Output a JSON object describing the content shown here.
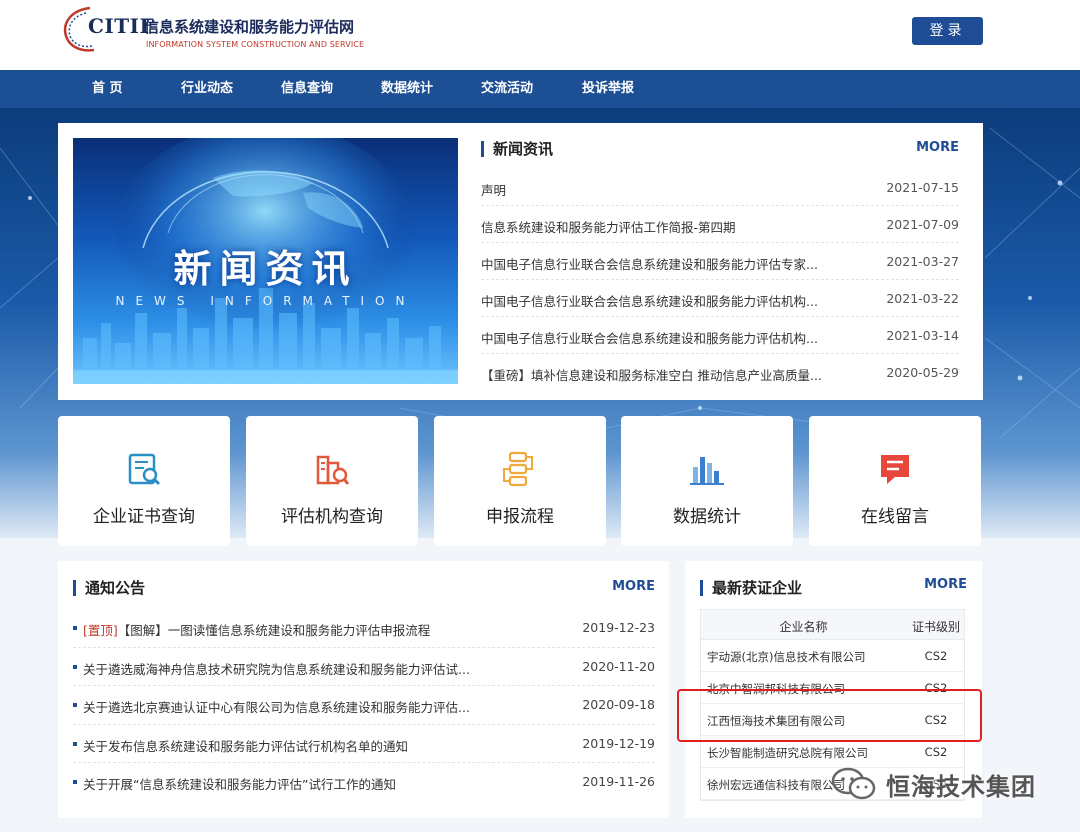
{
  "header": {
    "logo_brand": "CITIF",
    "logo_title": "信息系统建设和服务能力评估网",
    "logo_subtitle": "INFORMATION SYSTEM CONSTRUCTION AND SERVICE",
    "login_label": "登录"
  },
  "nav": {
    "items": [
      {
        "label": "首 页"
      },
      {
        "label": "行业动态"
      },
      {
        "label": "信息查询"
      },
      {
        "label": "数据统计"
      },
      {
        "label": "交流活动"
      },
      {
        "label": "投诉举报"
      }
    ]
  },
  "news": {
    "banner_title": "新闻资讯",
    "banner_subtitle": "NEWS INFORMATION",
    "section_title": "新闻资讯",
    "more_label": "MORE",
    "items": [
      {
        "title": "声明",
        "date": "2021-07-15"
      },
      {
        "title": "信息系统建设和服务能力评估工作简报-第四期",
        "date": "2021-07-09"
      },
      {
        "title": "中国电子信息行业联合会信息系统建设和服务能力评估专家...",
        "date": "2021-03-27"
      },
      {
        "title": "中国电子信息行业联合会信息系统建设和服务能力评估机构...",
        "date": "2021-03-22"
      },
      {
        "title": "中国电子信息行业联合会信息系统建设和服务能力评估机构...",
        "date": "2021-03-14"
      },
      {
        "title": "【重磅】填补信息建设和服务标准空白 推动信息产业高质量...",
        "date": "2020-05-29"
      }
    ]
  },
  "tiles": [
    {
      "label": "企业证书查询",
      "icon": "certificate-search-icon"
    },
    {
      "label": "评估机构查询",
      "icon": "building-search-icon"
    },
    {
      "label": "申报流程",
      "icon": "flow-icon"
    },
    {
      "label": "数据统计",
      "icon": "bar-chart-icon"
    },
    {
      "label": "在线留言",
      "icon": "message-icon"
    }
  ],
  "notice": {
    "section_title": "通知公告",
    "more_label": "MORE",
    "items": [
      {
        "tag": "[置顶]",
        "title": "【图解】一图读懂信息系统建设和服务能力评估申报流程",
        "date": "2019-12-23"
      },
      {
        "tag": "",
        "title": "关于遴选威海神舟信息技术研究院为信息系统建设和服务能力评估试...",
        "date": "2020-11-20"
      },
      {
        "tag": "",
        "title": "关于遴选北京赛迪认证中心有限公司为信息系统建设和服务能力评估...",
        "date": "2020-09-18"
      },
      {
        "tag": "",
        "title": "关于发布信息系统建设和服务能力评估试行机构名单的通知",
        "date": "2019-12-19"
      },
      {
        "tag": "",
        "title": "关于开展“信息系统建设和服务能力评估”试行工作的通知",
        "date": "2019-11-26"
      }
    ]
  },
  "certified": {
    "section_title": "最新获证企业",
    "more_label": "MORE",
    "col_company": "企业名称",
    "col_level": "证书级别",
    "rows": [
      {
        "company": "宇动源(北京)信息技术有限公司",
        "level": "CS2"
      },
      {
        "company": "北京中智润邦科技有限公司",
        "level": "CS2"
      },
      {
        "company": "江西恒海技术集团有限公司",
        "level": "CS2"
      },
      {
        "company": "长沙智能制造研究总院有限公司",
        "level": "CS2"
      },
      {
        "company": "徐州宏远通信科技有限公司",
        "level": "CS2"
      }
    ]
  },
  "watermark": {
    "text": "恒海技术集团"
  },
  "colors": {
    "primary": "#1f4d95",
    "nav": "#1d4f94",
    "highlight": "#e02020",
    "pin_tag": "#c0392b"
  }
}
